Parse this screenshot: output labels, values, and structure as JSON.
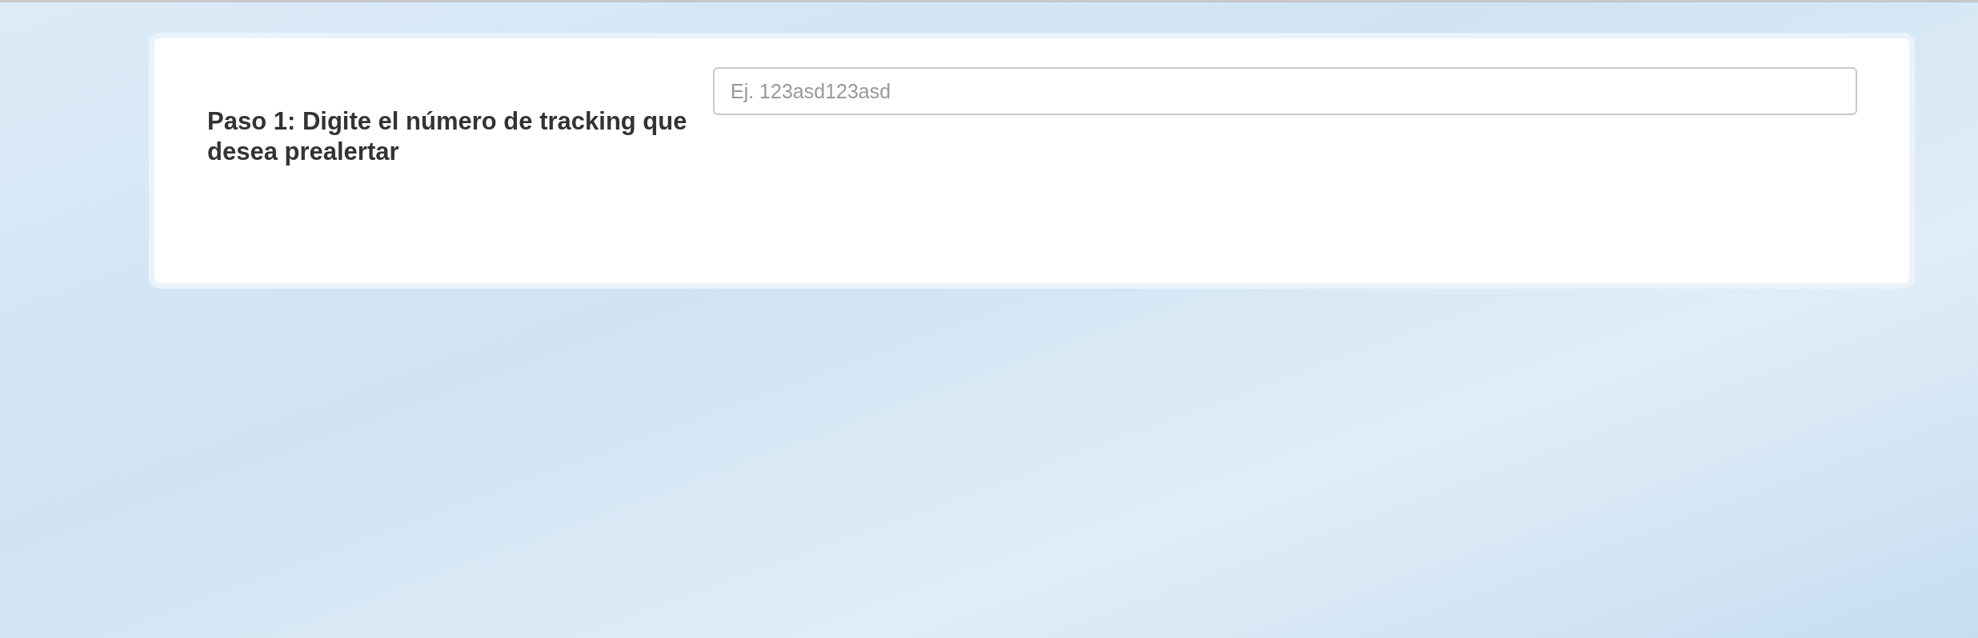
{
  "step": {
    "label": "Paso 1: Digite el número de tracking que desea prealertar"
  },
  "tracking_field": {
    "placeholder": "Ej. 123asd123asd"
  }
}
